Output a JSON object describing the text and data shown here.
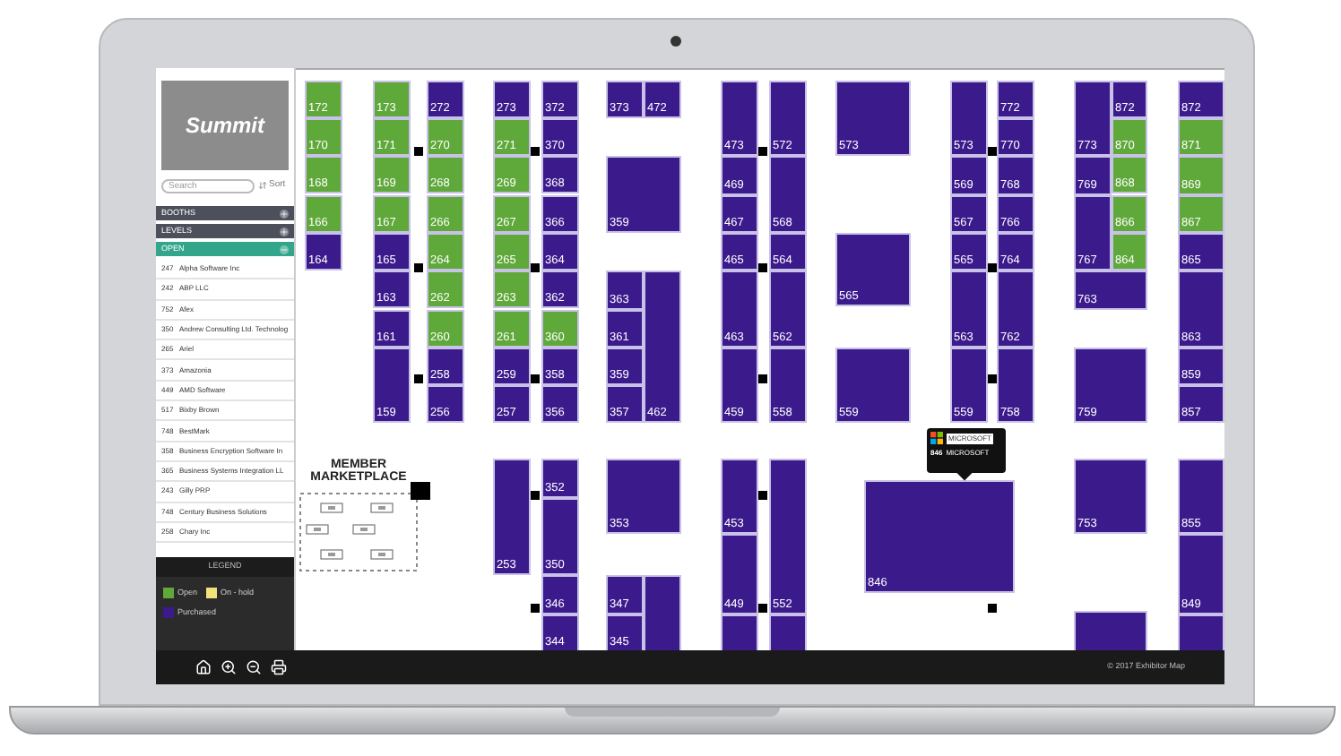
{
  "sidebar": {
    "logo": "Summit",
    "search": {
      "placeholder": "Search"
    },
    "sort_button": "Sort",
    "sections": [
      {
        "label": "BOOTHS",
        "expanded": false
      },
      {
        "label": "LEVELS",
        "expanded": false
      },
      {
        "label": "OPEN",
        "expanded": true
      }
    ],
    "exhibitors": [
      {
        "booth": "247",
        "name": "Alpha Software Inc"
      },
      {
        "booth": "242",
        "name": "ABP LLC"
      },
      {
        "booth": "752",
        "name": "Afex"
      },
      {
        "booth": "350",
        "name": "Andrew Consulting Ltd. Technolog"
      },
      {
        "booth": "265",
        "name": "Ariel"
      },
      {
        "booth": "373",
        "name": "Amazonia"
      },
      {
        "booth": "449",
        "name": "AMD Software"
      },
      {
        "booth": "517",
        "name": "Bixby Brown"
      },
      {
        "booth": "748",
        "name": "BestMark"
      },
      {
        "booth": "358",
        "name": "Business Encryption Software In"
      },
      {
        "booth": "365",
        "name": "Business Systems Integration LL"
      },
      {
        "booth": "243",
        "name": "Gilly PRP"
      },
      {
        "booth": "748",
        "name": "Century Business Solutions"
      },
      {
        "booth": "258",
        "name": "Chary Inc"
      }
    ],
    "legend": {
      "title": "LEGEND",
      "items": [
        {
          "label": "Open",
          "color": "#5fa83a"
        },
        {
          "label": "On - hold",
          "color": "#f1e27a"
        },
        {
          "label": "Purchased",
          "color": "#3b1a8c"
        }
      ]
    }
  },
  "map": {
    "booths": [
      {
        "number": "172",
        "color": "#5fa83a"
      },
      {
        "number": "170",
        "color": "#5fa83a"
      },
      {
        "number": "168",
        "color": "#5fa83a"
      },
      {
        "number": "166",
        "color": "#5fa83a"
      },
      {
        "number": "164",
        "color": "#3b1a8c"
      },
      {
        "number": "173",
        "color": "#5fa83a"
      },
      {
        "number": "171",
        "color": "#5fa83a"
      },
      {
        "number": "169",
        "color": "#5fa83a"
      },
      {
        "number": "167",
        "color": "#5fa83a"
      },
      {
        "number": "165",
        "color": "#3b1a8c"
      },
      {
        "number": "163",
        "color": "#3b1a8c"
      },
      {
        "number": "161",
        "color": "#3b1a8c"
      },
      {
        "number": "159",
        "color": "#3b1a8c"
      },
      {
        "number": "272",
        "color": "#3b1a8c"
      },
      {
        "number": "270",
        "color": "#5fa83a"
      },
      {
        "number": "268",
        "color": "#5fa83a"
      },
      {
        "number": "266",
        "color": "#5fa83a"
      },
      {
        "number": "264",
        "color": "#5fa83a"
      },
      {
        "number": "262",
        "color": "#5fa83a"
      },
      {
        "number": "260",
        "color": "#5fa83a"
      },
      {
        "number": "258",
        "color": "#3b1a8c"
      },
      {
        "number": "256",
        "color": "#3b1a8c"
      },
      {
        "number": "273",
        "color": "#3b1a8c"
      },
      {
        "number": "271",
        "color": "#5fa83a"
      },
      {
        "number": "269",
        "color": "#5fa83a"
      },
      {
        "number": "267",
        "color": "#5fa83a"
      },
      {
        "number": "265",
        "color": "#5fa83a"
      },
      {
        "number": "263",
        "color": "#5fa83a"
      },
      {
        "number": "261",
        "color": "#5fa83a"
      },
      {
        "number": "259",
        "color": "#3b1a8c"
      },
      {
        "number": "257",
        "color": "#3b1a8c"
      },
      {
        "number": "372",
        "color": "#3b1a8c"
      },
      {
        "number": "370",
        "color": "#3b1a8c"
      },
      {
        "number": "368",
        "color": "#3b1a8c"
      },
      {
        "number": "366",
        "color": "#3b1a8c"
      },
      {
        "number": "364",
        "color": "#3b1a8c"
      },
      {
        "number": "362",
        "color": "#3b1a8c"
      },
      {
        "number": "360",
        "color": "#5fa83a"
      },
      {
        "number": "358",
        "color": "#3b1a8c"
      },
      {
        "number": "356",
        "color": "#3b1a8c"
      },
      {
        "number": "373",
        "color": "#3b1a8c"
      },
      {
        "number": "359",
        "color": "#3b1a8c"
      },
      {
        "number": "363",
        "color": "#3b1a8c"
      },
      {
        "number": "361",
        "color": "#3b1a8c"
      },
      {
        "number": "359",
        "color": "#3b1a8c"
      },
      {
        "number": "357",
        "color": "#3b1a8c"
      },
      {
        "number": "472",
        "color": "#3b1a8c"
      },
      {
        "number": "462",
        "color": "#3b1a8c"
      },
      {
        "number": "473",
        "color": "#3b1a8c"
      },
      {
        "number": "469",
        "color": "#3b1a8c"
      },
      {
        "number": "467",
        "color": "#3b1a8c"
      },
      {
        "number": "465",
        "color": "#3b1a8c"
      },
      {
        "number": "463",
        "color": "#3b1a8c"
      },
      {
        "number": "459",
        "color": "#3b1a8c"
      },
      {
        "number": "572",
        "color": "#3b1a8c"
      },
      {
        "number": "568",
        "color": "#3b1a8c"
      },
      {
        "number": "564",
        "color": "#3b1a8c"
      },
      {
        "number": "562",
        "color": "#3b1a8c"
      },
      {
        "number": "558",
        "color": "#3b1a8c"
      },
      {
        "number": "573",
        "color": "#3b1a8c"
      },
      {
        "number": "565",
        "color": "#3b1a8c"
      },
      {
        "number": "559",
        "color": "#3b1a8c"
      },
      {
        "number": "573",
        "color": "#3b1a8c"
      },
      {
        "number": "569",
        "color": "#3b1a8c"
      },
      {
        "number": "567",
        "color": "#3b1a8c"
      },
      {
        "number": "565",
        "color": "#3b1a8c"
      },
      {
        "number": "563",
        "color": "#3b1a8c"
      },
      {
        "number": "559",
        "color": "#3b1a8c"
      },
      {
        "number": "772",
        "color": "#3b1a8c"
      },
      {
        "number": "770",
        "color": "#3b1a8c"
      },
      {
        "number": "768",
        "color": "#3b1a8c"
      },
      {
        "number": "766",
        "color": "#3b1a8c"
      },
      {
        "number": "764",
        "color": "#3b1a8c"
      },
      {
        "number": "762",
        "color": "#3b1a8c"
      },
      {
        "number": "758",
        "color": "#3b1a8c"
      },
      {
        "number": "773",
        "color": "#3b1a8c"
      },
      {
        "number": "769",
        "color": "#3b1a8c"
      },
      {
        "number": "767",
        "color": "#3b1a8c"
      },
      {
        "number": "763",
        "color": "#3b1a8c"
      },
      {
        "number": "759",
        "color": "#3b1a8c"
      },
      {
        "number": "872",
        "color": "#3b1a8c"
      },
      {
        "number": "870",
        "color": "#5fa83a"
      },
      {
        "number": "868",
        "color": "#5fa83a"
      },
      {
        "number": "866",
        "color": "#5fa83a"
      },
      {
        "number": "864",
        "color": "#5fa83a"
      },
      {
        "number": "872",
        "color": "#3b1a8c"
      },
      {
        "number": "871",
        "color": "#5fa83a"
      },
      {
        "number": "869",
        "color": "#5fa83a"
      },
      {
        "number": "867",
        "color": "#5fa83a"
      },
      {
        "number": "865",
        "color": "#3b1a8c"
      },
      {
        "number": "863",
        "color": "#3b1a8c"
      },
      {
        "number": "859",
        "color": "#3b1a8c"
      },
      {
        "number": "857",
        "color": "#3b1a8c"
      },
      {
        "number": "253",
        "color": "#3b1a8c"
      },
      {
        "number": "352",
        "color": "#3b1a8c"
      },
      {
        "number": "350",
        "color": "#3b1a8c"
      },
      {
        "number": "346",
        "color": "#3b1a8c"
      },
      {
        "number": "344",
        "color": "#3b1a8c"
      },
      {
        "number": "353",
        "color": "#3b1a8c"
      },
      {
        "number": "347",
        "color": "#3b1a8c"
      },
      {
        "number": "345",
        "color": "#3b1a8c"
      },
      {
        "color": "#3b1a8c"
      },
      {
        "number": "453",
        "color": "#3b1a8c"
      },
      {
        "number": "449",
        "color": "#3b1a8c"
      },
      {
        "color": "#3b1a8c"
      },
      {
        "number": "552",
        "color": "#3b1a8c"
      },
      {
        "color": "#3b1a8c"
      },
      {
        "number": "846",
        "color": "#3b1a8c"
      },
      {
        "number": "753",
        "color": "#3b1a8c"
      },
      {
        "color": "#3b1a8c"
      },
      {
        "number": "855",
        "color": "#3b1a8c"
      },
      {
        "number": "849",
        "color": "#3b1a8c"
      },
      {
        "color": "#3b1a8c"
      }
    ],
    "marketplace": "MEMBER MARKETPLACE",
    "tooltip": {
      "badge": "MICROSOFT",
      "booth": "846",
      "name": "MICROSOFT"
    }
  },
  "footer": {
    "copyright": "© 2017 Exhibitor Map"
  }
}
